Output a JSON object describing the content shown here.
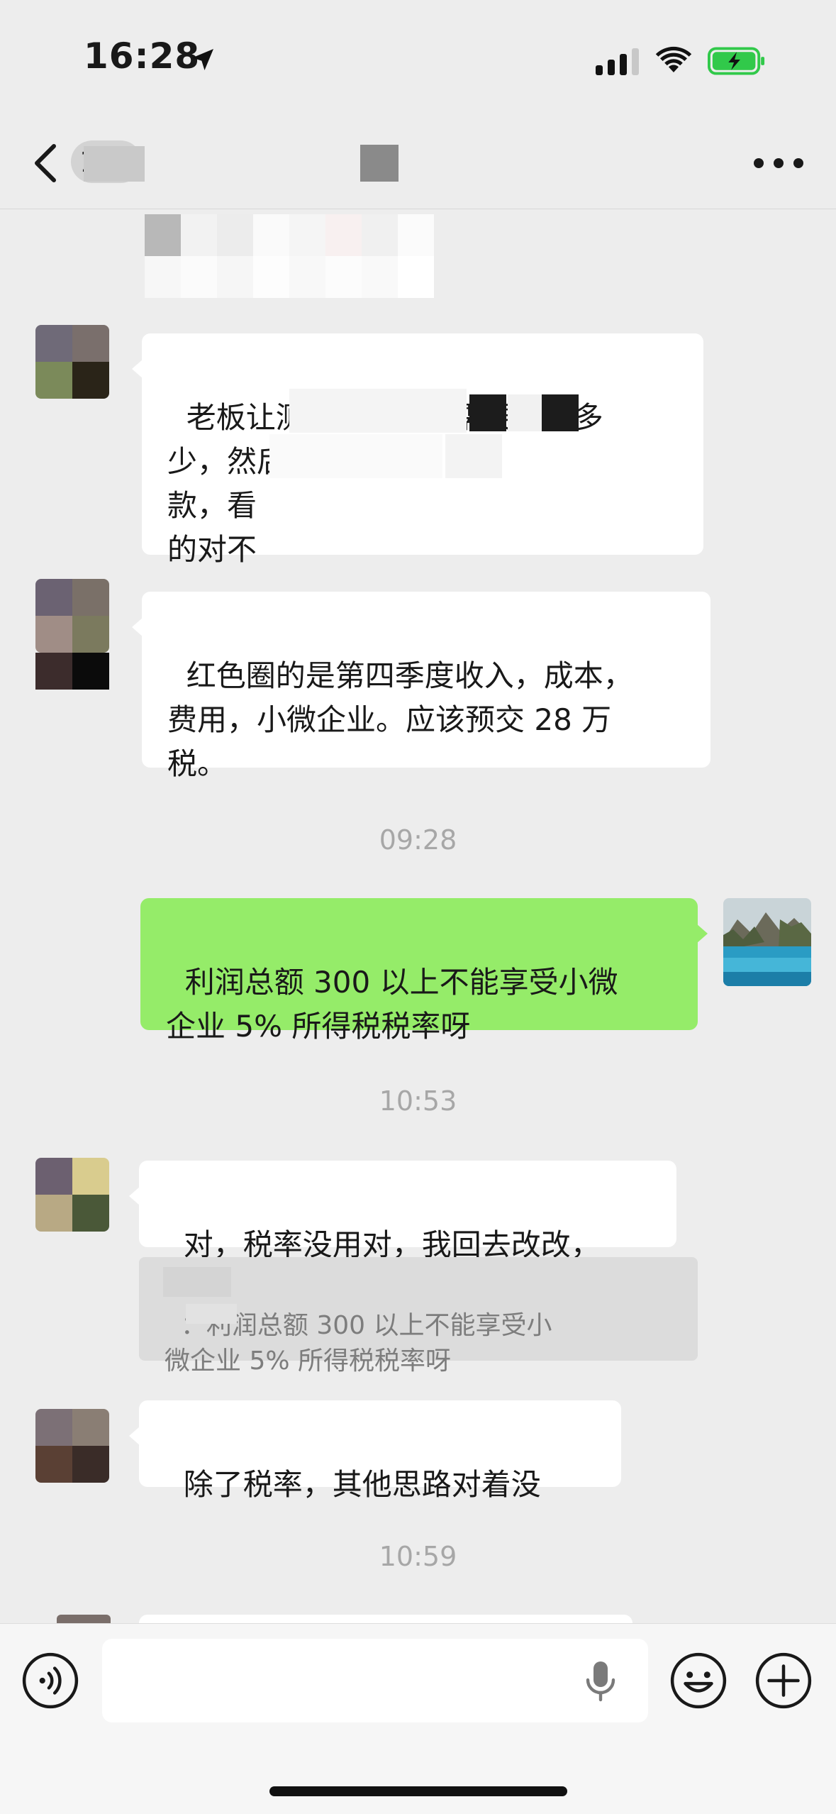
{
  "status_bar": {
    "time": "16:28",
    "icons": [
      "location-arrow-icon",
      "cellular-signal-icon",
      "wifi-icon",
      "battery-charging-icon"
    ],
    "battery_color": "#31c94a"
  },
  "nav": {
    "back_icon": "chevron-left-icon",
    "title_partial": "1",
    "more_icon": "more-dots-icon"
  },
  "messages": [
    {
      "side": "left",
      "text": "老板让测算第四季度需要缴纳多\n少，然后\n款，看\n的对不"
    },
    {
      "side": "left",
      "text": "红色圈的是第四季度收入，成本，\n费用，小微企业。应该预交 28 万\n税。"
    },
    {
      "timestamp": "09:28"
    },
    {
      "side": "right",
      "text": "利润总额 300 以上不能享受小微\n企业 5% 所得税税率呀"
    },
    {
      "timestamp": "10:53"
    },
    {
      "side": "left",
      "text": "对，税率没用对，我回去改改，",
      "quote": "：利润总额 300 以上不能享受小\n微企业 5% 所得税税率呀"
    },
    {
      "side": "left",
      "text": "除了税率，其他思路对着没"
    },
    {
      "timestamp": "10:59"
    }
  ],
  "input_bar": {
    "voice_icon": "voice-mode-icon",
    "mic_icon": "microphone-icon",
    "emoji_icon": "emoji-icon",
    "add_icon": "plus-circle-icon"
  },
  "colors": {
    "background": "#ededed",
    "bubble_mine": "#95ec69",
    "bubble_other": "#ffffff",
    "timestamp": "#a7a7a7",
    "quote_bg": "#dcdcdc"
  }
}
